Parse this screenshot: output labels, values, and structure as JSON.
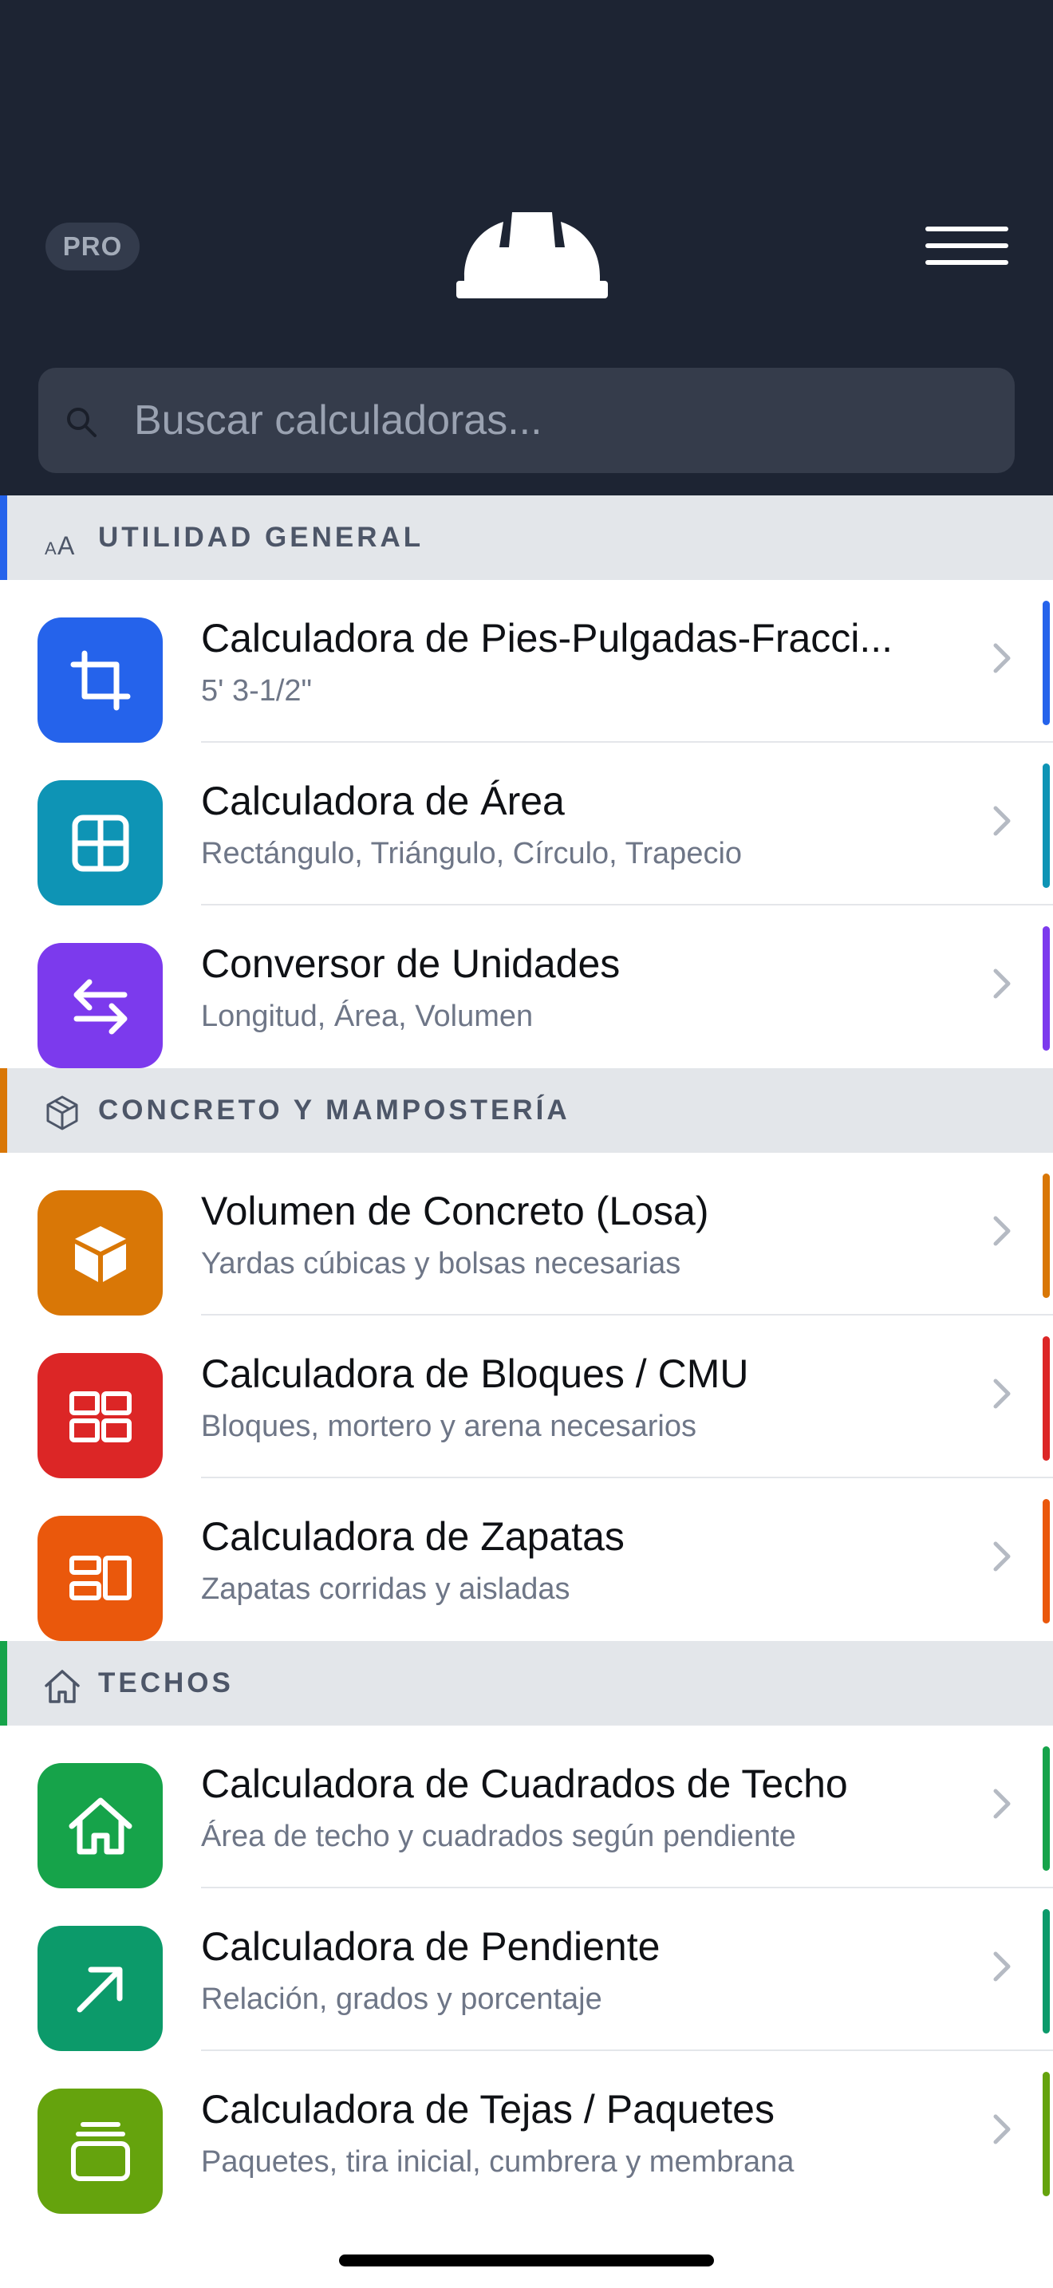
{
  "header": {
    "pro_label": "PRO",
    "logo": "hard-hat-icon",
    "menu_icon": "hamburger-menu-icon"
  },
  "search": {
    "placeholder": "Buscar calculadoras...",
    "value": ""
  },
  "sections": [
    {
      "title": "UTILIDAD GENERAL",
      "icon": "text-size-icon",
      "color": "#2563eb",
      "items": [
        {
          "title": "Calculadora de Pies-Pulgadas-Fracci...",
          "subtitle": "5' 3-1/2\"",
          "icon": "crop-icon",
          "color": "#2563eb"
        },
        {
          "title": "Calculadora de Área",
          "subtitle": "Rectángulo, Triángulo, Círculo, Trapecio",
          "icon": "grid-icon",
          "color": "#0e94b5"
        },
        {
          "title": "Conversor de Unidades",
          "subtitle": "Longitud, Área, Volumen",
          "icon": "arrows-swap-icon",
          "color": "#7c3aed"
        }
      ]
    },
    {
      "title": "CONCRETO Y MAMPOSTERÍA",
      "icon": "cube-icon",
      "color": "#d97706",
      "items": [
        {
          "title": "Volumen de Concreto (Losa)",
          "subtitle": "Yardas cúbicas y bolsas necesarias",
          "icon": "box-icon",
          "color": "#d97706"
        },
        {
          "title": "Calculadora de Bloques / CMU",
          "subtitle": "Bloques, mortero y arena necesarios",
          "icon": "blocks-icon",
          "color": "#dc2626"
        },
        {
          "title": "Calculadora de Zapatas",
          "subtitle": "Zapatas corridas y aisladas",
          "icon": "footing-icon",
          "color": "#ea580c"
        }
      ]
    },
    {
      "title": "TECHOS",
      "icon": "house-icon",
      "color": "#16a34a",
      "items": [
        {
          "title": "Calculadora de Cuadrados de Techo",
          "subtitle": "Área de techo y cuadrados según pendiente",
          "icon": "house-icon",
          "color": "#16a34a"
        },
        {
          "title": "Calculadora de Pendiente",
          "subtitle": "Relación, grados y porcentaje",
          "icon": "arrow-up-right-icon",
          "color": "#0c9a6a"
        },
        {
          "title": "Calculadora de Tejas / Paquetes",
          "subtitle": "Paquetes, tira inicial, cumbrera y membrana",
          "icon": "layers-icon",
          "color": "#65a30d"
        }
      ]
    }
  ]
}
